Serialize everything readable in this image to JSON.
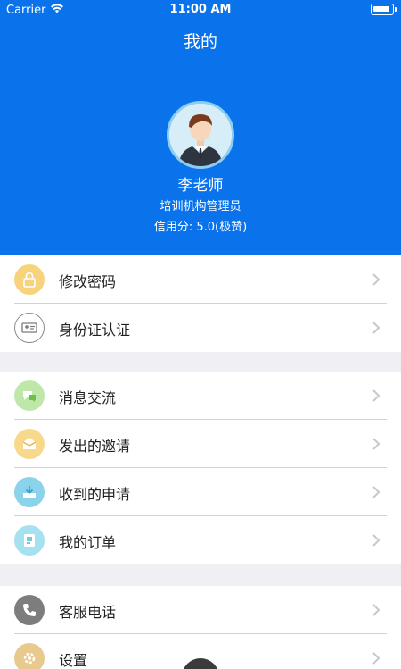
{
  "status_bar": {
    "carrier": "Carrier",
    "time": "11:00 AM"
  },
  "nav": {
    "title": "我的"
  },
  "profile": {
    "name": "李老师",
    "role": "培训机构管理员",
    "credit": "信用分: 5.0(极赞)"
  },
  "menu": {
    "group1": [
      {
        "label": "修改密码",
        "icon": "lock-icon",
        "color": "#f7d37e"
      },
      {
        "label": "身份证认证",
        "icon": "id-card-icon",
        "color": "#ffffff"
      }
    ],
    "group2": [
      {
        "label": "消息交流",
        "icon": "chat-icon",
        "color": "#bfe7a9"
      },
      {
        "label": "发出的邀请",
        "icon": "send-invite-icon",
        "color": "#f6d98b"
      },
      {
        "label": "收到的申请",
        "icon": "received-application-icon",
        "color": "#8bd3ea"
      },
      {
        "label": "我的订单",
        "icon": "order-list-icon",
        "color": "#a6e1ef"
      }
    ],
    "group3": [
      {
        "label": "客服电话",
        "icon": "phone-icon",
        "color": "#7d7d7d"
      },
      {
        "label": "设置",
        "icon": "settings-icon",
        "color": "#e8c98e"
      }
    ]
  }
}
